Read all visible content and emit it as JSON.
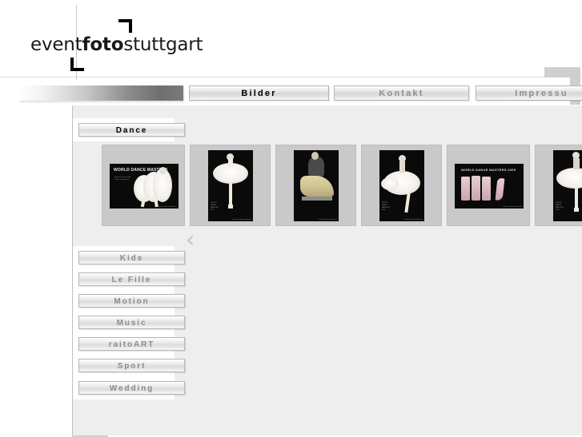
{
  "site": {
    "logo_part1": "event",
    "logo_part2": "foto",
    "logo_part3": "stuttgart"
  },
  "nav": {
    "tabs": [
      {
        "label": "",
        "name": "nav-tab-gradient",
        "active": false
      },
      {
        "label": "Bilder",
        "name": "nav-tab-bilder",
        "active": true
      },
      {
        "label": "Kontakt",
        "name": "nav-tab-kontakt",
        "active": false
      },
      {
        "label": "Impressu",
        "name": "nav-tab-impressum",
        "active": false
      }
    ]
  },
  "sidebar": {
    "categories": [
      {
        "label": "Dance",
        "active": true
      },
      {
        "label": "Kids",
        "active": false
      },
      {
        "label": "Le Fille",
        "active": false
      },
      {
        "label": "Motion",
        "active": false
      },
      {
        "label": "Music",
        "active": false
      },
      {
        "label": "raitoART",
        "active": false
      },
      {
        "label": "Sport",
        "active": false
      },
      {
        "label": "Wedding",
        "active": false
      }
    ]
  },
  "gallery": {
    "prev_arrow": "‹",
    "thumbnails": [
      {
        "orientation": "landscape",
        "title": "WORLD DANCE MASTERS",
        "subtitle": "they wish to take away\nPeople in movement",
        "credit": "www.eventfoto-stuttgart.de",
        "alt": "world-dance-masters-poster-dancers"
      },
      {
        "orientation": "portrait",
        "title": "",
        "subtitle": "WORLD\nDANCE\nMASTERS\n2009",
        "credit": "www.eventfoto-stuttgart.de",
        "alt": "ballerina-in-white-tutu"
      },
      {
        "orientation": "portrait",
        "title": "",
        "subtitle": "",
        "credit": "www.eventfoto-stuttgart.de",
        "alt": "dancer-in-dark-costume"
      },
      {
        "orientation": "portrait",
        "title": "",
        "subtitle": "WORLD\nDANCE\nMASTERS\n2009",
        "credit": "www.eventfoto-stuttgart.de",
        "alt": "dancer-in-flowing-white-dress"
      },
      {
        "orientation": "landscape",
        "title": "WORLD DANCE MASTERS 2009",
        "subtitle": "",
        "credit": "www.eventfoto-stuttgart.de",
        "alt": "pink-fabric-dress-panels"
      },
      {
        "orientation": "portrait",
        "title": "",
        "subtitle": "WORLD\nDANCE\nMASTERS\n2009",
        "credit": "",
        "alt": "ballerina-back-view-tutu"
      }
    ]
  },
  "colors": {
    "page_background": "#ffffff",
    "content_background": "#eeeeee",
    "thumb_frame": "#c9c9c9",
    "button_text_inactive": "#8c8c8c",
    "button_text_active": "#000000",
    "crop_mark": "#cfcfcf",
    "arrow": "#c2c2c2"
  }
}
